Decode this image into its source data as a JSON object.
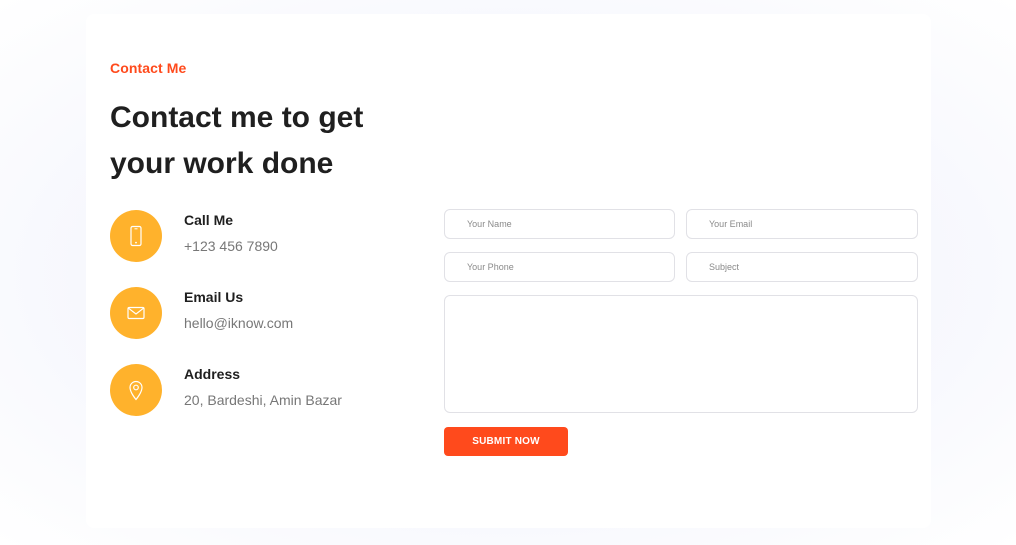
{
  "section": {
    "eyebrow": "Contact Me",
    "headline": "Contact me to get your work done"
  },
  "contacts": [
    {
      "label": "Call Me",
      "value": "+123 456 7890",
      "icon": "phone-icon"
    },
    {
      "label": "Email Us",
      "value": "hello@iknow.com",
      "icon": "mail-icon"
    },
    {
      "label": "Address",
      "value": "20, Bardeshi, Amin Bazar",
      "icon": "map-pin-icon"
    }
  ],
  "form": {
    "name_placeholder": "Your Name",
    "email_placeholder": "Your Email",
    "phone_placeholder": "Your Phone",
    "subject_placeholder": "Subject",
    "message_placeholder": "",
    "submit_label": "SUBMIT NOW"
  },
  "colors": {
    "accent": "#ff4a1c",
    "icon_bg": "#ffb22c",
    "heading": "#1f1f1f",
    "muted": "#777777"
  }
}
